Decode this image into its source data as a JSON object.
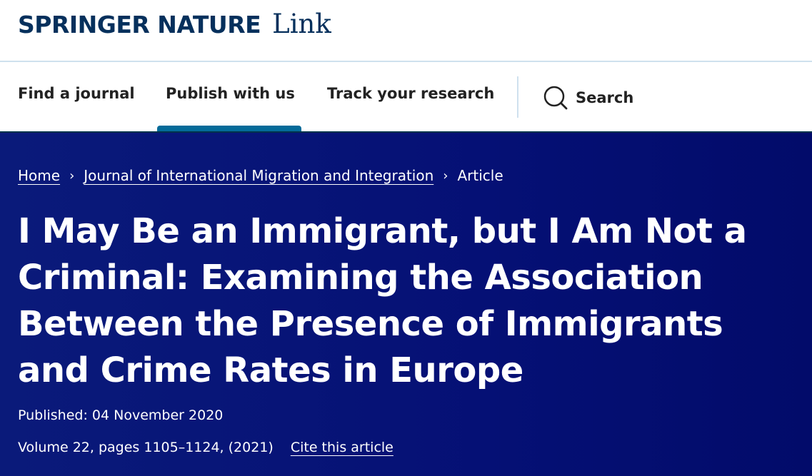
{
  "logo": {
    "brand": "SPRINGER NATURE",
    "product": "Link"
  },
  "nav": {
    "items": [
      {
        "label": "Find a journal"
      },
      {
        "label": "Publish with us"
      },
      {
        "label": "Track your research"
      }
    ],
    "search_label": "Search"
  },
  "breadcrumb": {
    "home": "Home",
    "journal": "Journal of International Migration and Integration",
    "current": "Article",
    "separator": "›"
  },
  "article": {
    "title": "I May Be an Immigrant, but I Am Not a Criminal: Examining the Association Between the Presence of Immigrants and Crime Rates in Europe",
    "published": "Published: 04 November 2020",
    "volume": "Volume 22, pages 1105–1124, (2021)",
    "cite": "Cite this article"
  },
  "colors": {
    "brand_navy": "#06305c",
    "hero_bg": "#051075",
    "active_underline": "#046b99"
  }
}
